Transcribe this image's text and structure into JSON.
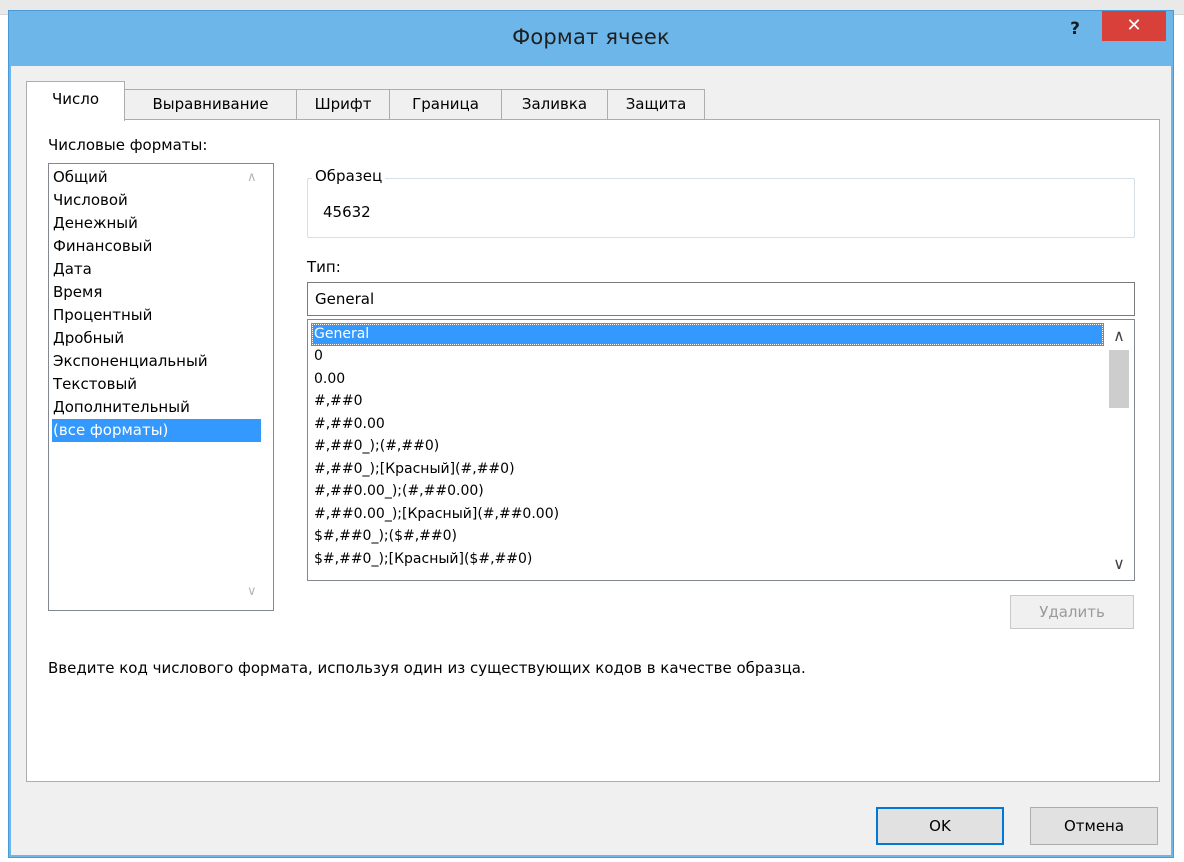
{
  "window": {
    "title": "Формат ячеек",
    "help_label": "?",
    "close_label": "✕"
  },
  "tabs": [
    {
      "label": "Число",
      "active": true
    },
    {
      "label": "Выравнивание"
    },
    {
      "label": "Шрифт"
    },
    {
      "label": "Граница"
    },
    {
      "label": "Заливка"
    },
    {
      "label": "Защита"
    }
  ],
  "category": {
    "label": "Числовые форматы:",
    "items": [
      "Общий",
      "Числовой",
      "Денежный",
      "Финансовый",
      "Дата",
      "Время",
      "Процентный",
      "Дробный",
      "Экспоненциальный",
      "Текстовый",
      "Дополнительный",
      "(все форматы)"
    ],
    "selected_index": 11
  },
  "sample": {
    "legend": "Образец",
    "value": "45632"
  },
  "type": {
    "label": "Тип:",
    "value": "General",
    "items": [
      "General",
      "0",
      "0.00",
      "#,##0",
      "#,##0.00",
      "#,##0_);(#,##0)",
      "#,##0_);[Красный](#,##0)",
      "#,##0.00_);(#,##0.00)",
      "#,##0.00_);[Красный](#,##0.00)",
      "$#,##0_);($#,##0)",
      "$#,##0_);[Красный]($#,##0)"
    ],
    "selected_index": 0
  },
  "delete_button": "Удалить",
  "description": "Введите код числового формата, используя один из существующих кодов в качестве образца.",
  "buttons": {
    "ok": "OK",
    "cancel": "Отмена"
  },
  "colors": {
    "titlebar": "#6cb6ea",
    "close": "#d9403a",
    "selection": "#3399ff"
  }
}
